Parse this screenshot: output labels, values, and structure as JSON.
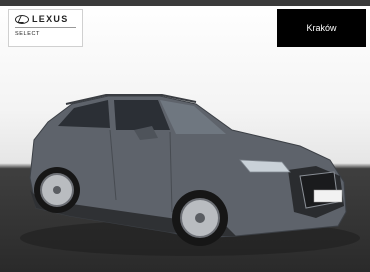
{
  "badge": {
    "brand": "LEXUS",
    "sub": "SELECT"
  },
  "location": "Kraków",
  "colors": {
    "car_body": "#5e636b",
    "floor": "#2c2c2c",
    "badge_bg": "#ffffff",
    "location_bg": "#000000"
  },
  "icons": [
    "lexus-logo-icon"
  ]
}
